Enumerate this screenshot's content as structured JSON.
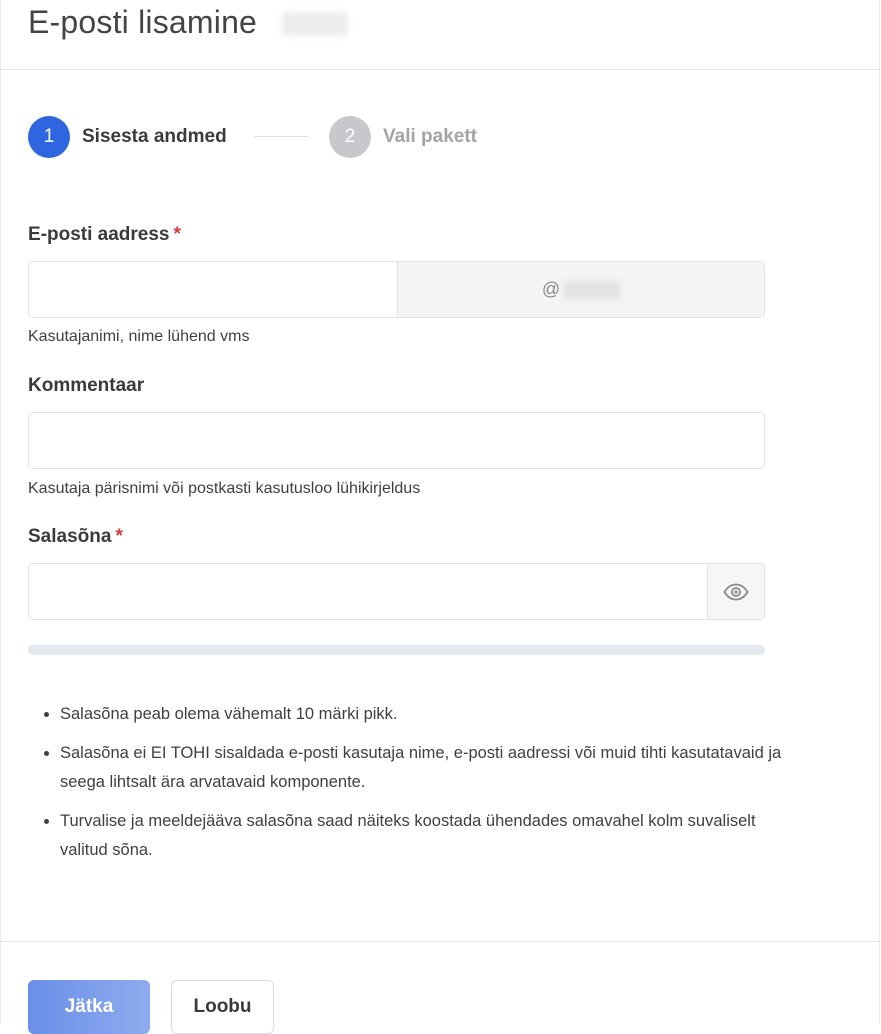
{
  "header": {
    "title": "E-posti lisamine"
  },
  "stepper": {
    "steps": [
      {
        "number": "1",
        "label": "Sisesta andmed",
        "active": true
      },
      {
        "number": "2",
        "label": "Vali pakett",
        "active": false
      }
    ]
  },
  "form": {
    "email": {
      "label": "E-posti aadress",
      "required_mark": "*",
      "value": "",
      "domain_prefix": "@",
      "help": "Kasutajanimi, nime lühend vms"
    },
    "comment": {
      "label": "Kommentaar",
      "value": "",
      "help": "Kasutaja pärisnimi või postkasti kasutusloo lühikirjeldus"
    },
    "password": {
      "label": "Salasõna",
      "required_mark": "*",
      "value": "",
      "toggle_icon": "eye-icon",
      "strength": 0
    }
  },
  "rules": [
    "Salasõna peab olema vähemalt 10 märki pikk.",
    "Salasõna ei EI TOHI sisaldada e-posti kasutaja nime, e-posti aadressi või muid tihti kasutatavaid ja seega lihtsalt ära arvatavaid komponente.",
    "Turvalise ja meeldejääva salasõna saad näiteks koostada ühendades omavahel kolm suvaliselt valitud sõna."
  ],
  "actions": {
    "continue_label": "Jätka",
    "cancel_label": "Loobu"
  },
  "colors": {
    "accent": "#2f66e0",
    "step_inactive": "#c8c8cc",
    "required": "#d63b3b",
    "strength_track": "#e5e9f2"
  }
}
